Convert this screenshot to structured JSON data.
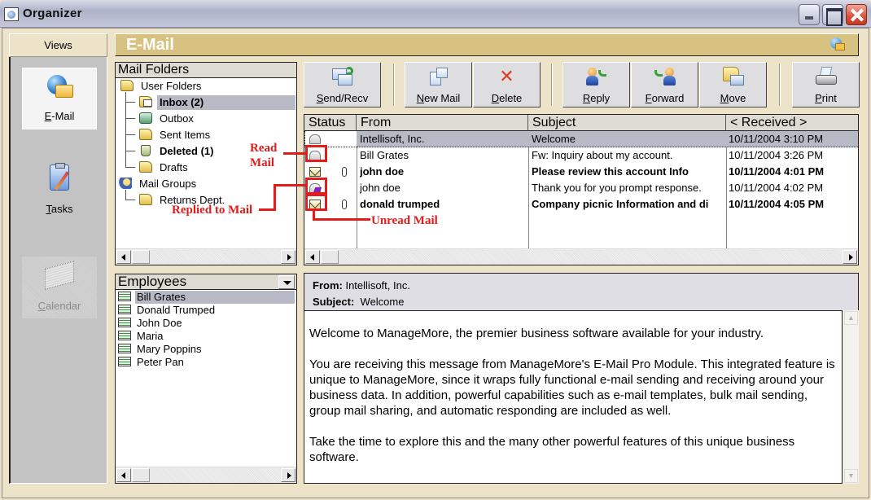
{
  "window": {
    "title": "Organizer",
    "controls": {
      "minimize": "minimize",
      "maximize": "maximize",
      "close": "close"
    }
  },
  "views": {
    "header": "Views",
    "items": [
      {
        "label": "E-Mail",
        "icon": "email-globe-icon",
        "state": "active"
      },
      {
        "label": "Tasks",
        "icon": "tasks-clipboard-icon",
        "state": "normal"
      },
      {
        "label": "Calendar",
        "icon": "calendar-icon",
        "state": "disabled"
      }
    ]
  },
  "module": {
    "title": "E-Mail"
  },
  "toolbar": {
    "buttons": [
      {
        "label": "Send/Recv",
        "accel": "S",
        "icon": "send-receive-icon"
      },
      {
        "label": "New Mail",
        "accel": "N",
        "icon": "new-mail-icon"
      },
      {
        "label": "Delete",
        "accel": "D",
        "icon": "delete-x-icon"
      },
      {
        "label": "Reply",
        "accel": "R",
        "icon": "reply-icon"
      },
      {
        "label": "Forward",
        "accel": "F",
        "icon": "forward-icon"
      },
      {
        "label": "Move",
        "accel": "M",
        "icon": "move-folder-icon"
      },
      {
        "label": "Print",
        "accel": "P",
        "icon": "printer-icon"
      }
    ]
  },
  "mail_folders": {
    "title": "Mail Folders",
    "tree": [
      {
        "label": "User Folders",
        "level": 0,
        "icon": "folders-icon"
      },
      {
        "label": "Inbox (2)",
        "level": 1,
        "icon": "inbox-icon",
        "bold": true,
        "selected": true
      },
      {
        "label": "Outbox",
        "level": 1,
        "icon": "outbox-icon"
      },
      {
        "label": "Sent Items",
        "level": 1,
        "icon": "sent-items-icon"
      },
      {
        "label": "Deleted (1)",
        "level": 1,
        "icon": "trash-icon",
        "bold": true
      },
      {
        "label": "Drafts",
        "level": 1,
        "icon": "drafts-icon"
      },
      {
        "label": "Mail Groups",
        "level": 0,
        "icon": "mail-groups-icon"
      },
      {
        "label": "Returns Dept.",
        "level": 1,
        "icon": "group-folder-icon"
      }
    ]
  },
  "employees": {
    "title": "Employees",
    "items": [
      {
        "name": "Bill Grates",
        "selected": true
      },
      {
        "name": "Donald Trumped"
      },
      {
        "name": "John Doe"
      },
      {
        "name": "Maria"
      },
      {
        "name": "Mary Poppins"
      },
      {
        "name": "Peter Pan"
      }
    ]
  },
  "message_list": {
    "columns": [
      "Status",
      "From",
      "Subject",
      "< Received >"
    ],
    "rows": [
      {
        "status": "read",
        "attachment": false,
        "from": "Intellisoft, Inc.",
        "subject": "Welcome",
        "received": "10/11/2004  3:10 PM",
        "bold": false,
        "selected": true
      },
      {
        "status": "read",
        "attachment": false,
        "from": "Bill Grates",
        "subject": "Fw: Inquiry about my account.",
        "received": "10/11/2004  3:26 PM",
        "bold": false
      },
      {
        "status": "unread",
        "attachment": true,
        "from": "john doe",
        "subject": "Please review this account Info",
        "received": "10/11/2004  4:01 PM",
        "bold": true
      },
      {
        "status": "replied",
        "attachment": false,
        "from": "john doe",
        "subject": "Thank you for you prompt response.",
        "received": "10/11/2004  4:02 PM",
        "bold": false
      },
      {
        "status": "unread",
        "attachment": true,
        "from": "donald trumped",
        "subject": "Company picnic Information and di",
        "received": "10/11/2004  4:05 PM",
        "bold": true
      }
    ]
  },
  "annotations": {
    "read": [
      "Read",
      "Mail"
    ],
    "replied": "Replied to Mail",
    "unread": "Unread Mail",
    "color": "#e31b1b"
  },
  "preview": {
    "from_label": "From:",
    "from_value": "Intellisoft, Inc.",
    "subject_label": "Subject:",
    "subject_value": "Welcome",
    "paragraphs": [
      "Welcome to ManageMore, the premier business software available for your industry.",
      "You are receiving this message from ManageMore's E-Mail Pro Module.  This integrated feature is unique to ManageMore, since it wraps fully functional e-mail sending and receiving around your business data.  In addition, powerful capabilities such as e-mail templates, bulk mail sending, group mail sharing, and automatic responding are included as well.",
      "Take the time to explore this and the many other powerful features of this unique business software."
    ]
  },
  "colors": {
    "module_bar": "#d8c282",
    "selection": "#b7b9c5",
    "background": "#ece3c8"
  }
}
